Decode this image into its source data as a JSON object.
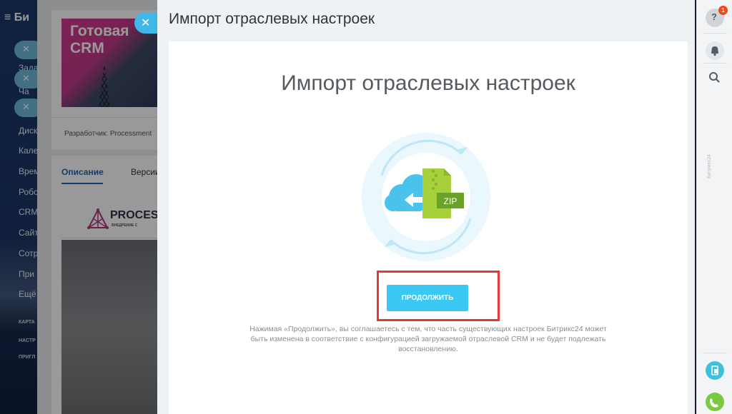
{
  "left_sidebar": {
    "app_name": "Би",
    "items": [
      "Зада",
      "Ча",
      "Диск",
      "Кале",
      "Врем",
      "Робо",
      "CRM",
      "Сайт",
      "Сотр",
      "При",
      "Ещё"
    ],
    "small_items": [
      "КАРТА",
      "НАСТР",
      "ПРИГЛ"
    ]
  },
  "background_app": {
    "card_title": "Готовая CRM",
    "developer_label": "Разработчик: Processment",
    "tab_description": "Описание",
    "tab_versions": "Версии",
    "logo_text": "PROCESS",
    "logo_subtext": "ВНЕДРЕНИЕ С"
  },
  "slider": {
    "title": "Импорт отраслевых настроек",
    "heading": "Импорт отраслевых настроек",
    "zip_label": "ZIP",
    "continue_label": "ПРОДОЛЖИТЬ",
    "disclaimer": "Нажимая «Продолжить», вы соглашаетесь с тем, что часть существующих настроек Битрикс24 может быть изменена в соответствие с конфигурацией загружаемой отраслевой CRM и не будет подлежать восстановлению."
  },
  "right_panel": {
    "help_badge": "1",
    "vertical_text": "Битрикс24"
  },
  "colors": {
    "accent": "#3bc8f5",
    "highlight": "#e53935",
    "zip_green": "#a7d13c"
  }
}
